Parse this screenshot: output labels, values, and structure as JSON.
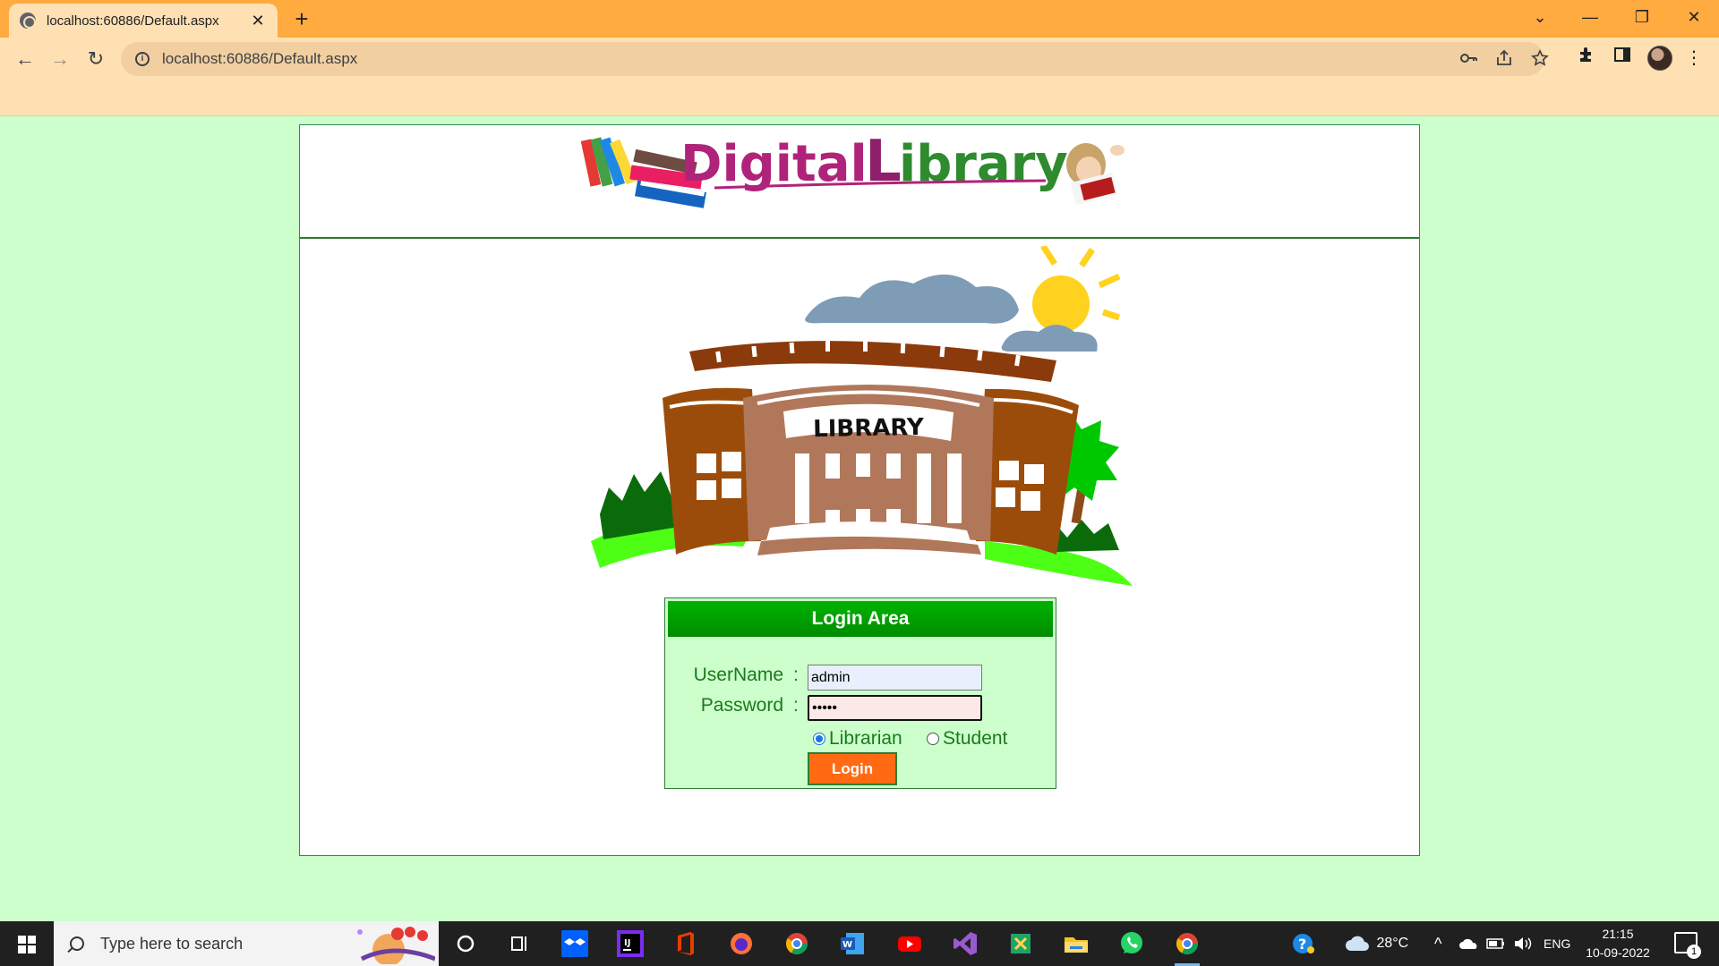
{
  "browser": {
    "tab_title": "localhost:60886/Default.aspx",
    "tab_close": "✕",
    "new_tab": "+",
    "url": "localhost:60886/Default.aspx",
    "window_controls": {
      "tabs_menu": "⌄",
      "minimize": "—",
      "restore": "❐",
      "close": "✕"
    },
    "nav": {
      "back": "←",
      "forward": "→",
      "reload": "↻"
    }
  },
  "page": {
    "banner": {
      "word1": "Digital",
      "word2_initial": "L",
      "word2_rest": "ibrary"
    },
    "illustration_sign": "LIBRARY",
    "login": {
      "heading": "Login Area",
      "username_label": "UserName",
      "password_label": "Password",
      "colon": ":",
      "username_value": "admin",
      "password_value": "•••••",
      "role_options": [
        "Librarian",
        "Student"
      ],
      "role_selected": "Librarian",
      "button_label": "Login"
    },
    "colors": {
      "page_background": "#ccffcc",
      "header_green": "#00b300",
      "button_orange": "#ff6a13",
      "label_green": "#1b7a1b"
    }
  },
  "taskbar": {
    "search_placeholder": "Type here to search",
    "weather_temp": "28°C",
    "language": "ENG",
    "time": "21:15",
    "date": "10-09-2022",
    "notification_count": "1",
    "apps": [
      "cortana-icon",
      "task-view-icon",
      "dropbox-icon",
      "intellij-icon",
      "office-icon",
      "firefox-icon",
      "chrome-icon",
      "word-icon",
      "youtube-icon",
      "visual-studio-icon",
      "excel-icon",
      "file-explorer-icon",
      "whatsapp-icon",
      "chrome-active-icon"
    ]
  }
}
